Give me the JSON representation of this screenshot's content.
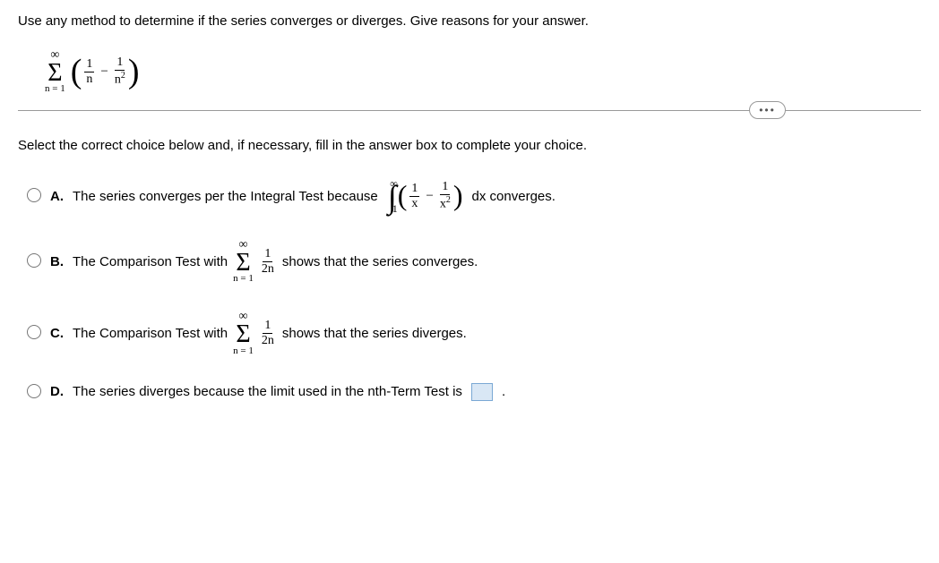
{
  "question": "Use any method to determine if the series converges or diverges. Give reasons for your answer.",
  "series": {
    "upper": "∞",
    "lower": "n = 1",
    "term1_num": "1",
    "term1_den": "n",
    "term2_num": "1",
    "term2_den_base": "n",
    "term2_den_exp": "2"
  },
  "instruction": "Select the correct choice below and, if necessary, fill in the answer box to complete your choice.",
  "choices": {
    "a": {
      "label": "A.",
      "text_before": "The series converges per the Integral Test because",
      "integral_upper": "∞",
      "integral_lower": "1",
      "int_t1_num": "1",
      "int_t1_den": "x",
      "int_t2_num": "1",
      "int_t2_den_base": "x",
      "int_t2_den_exp": "2",
      "text_after": "dx converges."
    },
    "b": {
      "label": "B.",
      "text_before": "The Comparison Test with",
      "sum_upper": "∞",
      "sum_lower": "n = 1",
      "frac_num": "1",
      "frac_den": "2n",
      "text_after": "shows that the series converges."
    },
    "c": {
      "label": "C.",
      "text_before": "The Comparison Test with",
      "sum_upper": "∞",
      "sum_lower": "n = 1",
      "frac_num": "1",
      "frac_den": "2n",
      "text_after": "shows that the series diverges."
    },
    "d": {
      "label": "D.",
      "text_before": "The series diverges because the limit used in the nth-Term Test is",
      "text_after": "."
    }
  }
}
